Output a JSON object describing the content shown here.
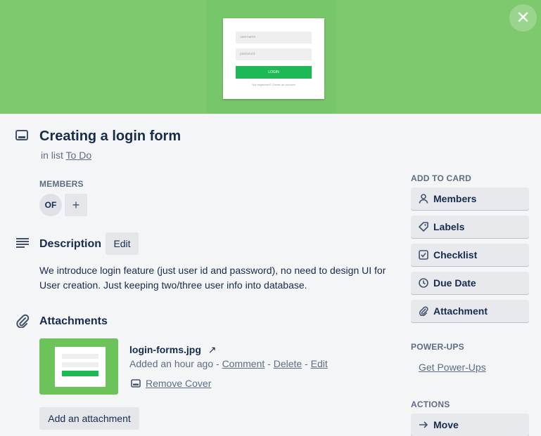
{
  "cover": {
    "mock_username": "username",
    "mock_password": "password",
    "mock_login": "LOGIN",
    "mock_footer": "Not registered? Create an account",
    "bg_color": "#7ec96d"
  },
  "close_label": "✕",
  "card": {
    "title": "Creating a login form",
    "in_list_prefix": "in list",
    "list_name": "To Do"
  },
  "members": {
    "label": "MEMBERS",
    "avatar_initials": "OF",
    "add_label": "+"
  },
  "description": {
    "heading": "Description",
    "edit_label": "Edit",
    "text": "We introduce login feature (just user id and password), no need to design UI for User creation. Just keeping two/three user info into database."
  },
  "attachments": {
    "heading": "Attachments",
    "file_name": "login-forms.jpg",
    "open_icon": "↗",
    "added": "Added an hour ago",
    "sep1": " - ",
    "comment": "Comment",
    "sep2": " - ",
    "delete": "Delete",
    "sep3": " - ",
    "edit": "Edit",
    "remove_cover": "Remove Cover",
    "add_button": "Add an attachment"
  },
  "sidebar": {
    "add_to_card_label": "ADD TO CARD",
    "buttons": [
      {
        "label": "Members",
        "icon": "person-icon"
      },
      {
        "label": "Labels",
        "icon": "tag-icon"
      },
      {
        "label": "Checklist",
        "icon": "checklist-icon"
      },
      {
        "label": "Due Date",
        "icon": "clock-icon"
      },
      {
        "label": "Attachment",
        "icon": "paperclip-icon"
      }
    ],
    "powerups_label": "POWER-UPS",
    "get_powerups": "Get Power-Ups",
    "actions_label": "ACTIONS",
    "move_label": "Move"
  }
}
